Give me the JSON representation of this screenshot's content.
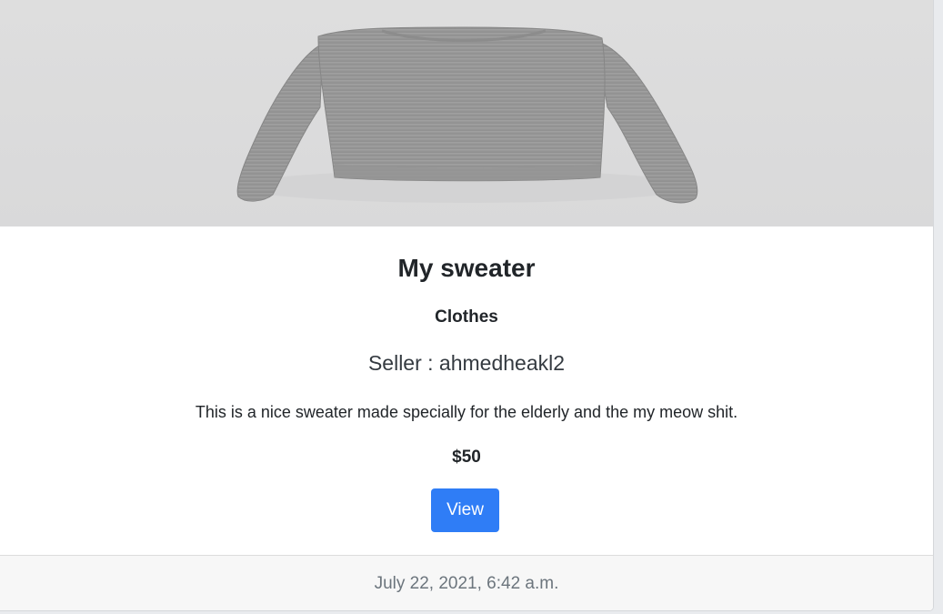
{
  "product": {
    "image_alt": "grey knitted sweater",
    "title": "My sweater",
    "category": "Clothes",
    "seller": "Seller : ahmedheakl2",
    "description": "This is a nice sweater made specially for the elderly and the my meow shit.",
    "price": "$50",
    "view_label": "View",
    "posted_at": "July 22, 2021, 6:42 a.m."
  },
  "colors": {
    "primary": "#2f7df6",
    "image_bg": "#dcdcdd",
    "sweater": "#9a9a9a",
    "footer_bg": "#f7f7f7"
  }
}
